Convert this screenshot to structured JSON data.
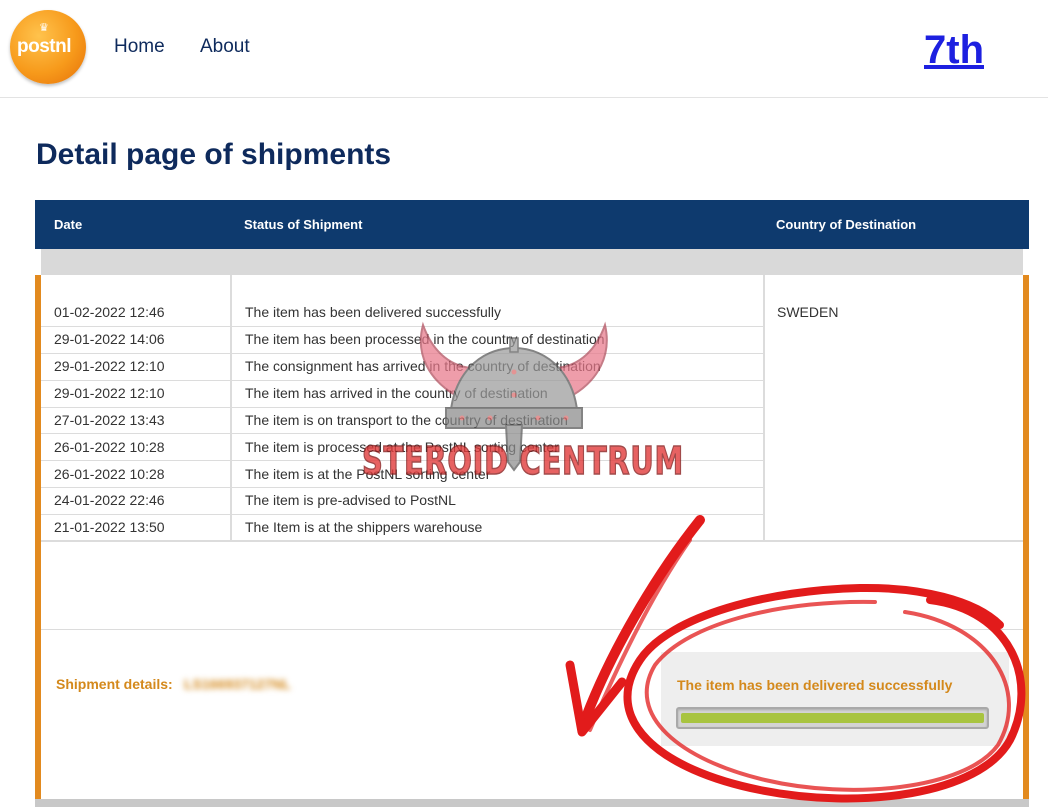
{
  "header": {
    "logo_text": "postnl",
    "nav": {
      "home": "Home",
      "about": "About"
    },
    "badge": "7th"
  },
  "page_title": "Detail page of shipments",
  "table": {
    "headers": {
      "date": "Date",
      "status": "Status of Shipment",
      "country": "Country of Destination"
    },
    "rows": [
      {
        "date": "01-02-2022 12:46",
        "status": "The item has been delivered successfully"
      },
      {
        "date": "29-01-2022 14:06",
        "status": "The item has been processed in the country of destination"
      },
      {
        "date": "29-01-2022 12:10",
        "status": "The consignment has arrived in the country of destination"
      },
      {
        "date": "29-01-2022 12:10",
        "status": "The item has arrived in the country of destination"
      },
      {
        "date": "27-01-2022 13:43",
        "status": "The item is on transport to the country of destination"
      },
      {
        "date": "26-01-2022 10:28",
        "status": "The item is processed at the PostNL sorting center"
      },
      {
        "date": "26-01-2022 10:28",
        "status": "The item is at the PostNL sorting center"
      },
      {
        "date": "24-01-2022 22:46",
        "status": "The item is pre-advised to PostNL"
      },
      {
        "date": "21-01-2022 13:50",
        "status": "The Item is at the shippers warehouse"
      }
    ],
    "country": "SWEDEN"
  },
  "details": {
    "label": "Shipment details:",
    "tracking_code": "LS166937127NL",
    "status_text": "The item has been delivered successfully",
    "progress": 1.0
  },
  "watermark": {
    "text": "STEROID CENTRUM"
  },
  "colors": {
    "navy": "#0e3a6e",
    "orange": "#e28a1f",
    "status_orange": "#d4891c",
    "progress_green": "#a8c440",
    "annotation_red": "#e21b1b"
  }
}
